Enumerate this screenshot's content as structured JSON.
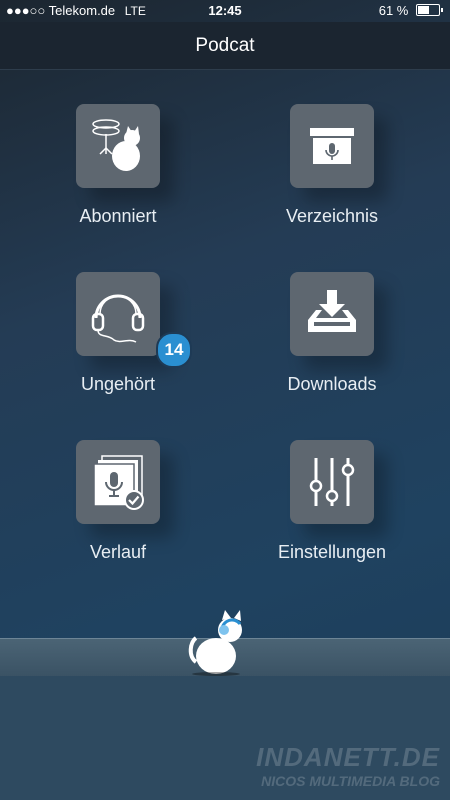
{
  "status_bar": {
    "signal": "●●●○○",
    "carrier": "Telekom.de",
    "network": "LTE",
    "time": "12:45",
    "battery_percent": "61 %",
    "battery_level": 0.61
  },
  "navbar": {
    "title": "Podcat"
  },
  "menu": {
    "subscribed": {
      "label": "Abonniert",
      "icon": "cat-satellite-icon"
    },
    "directory": {
      "label": "Verzeichnis",
      "icon": "archive-box-icon"
    },
    "unplayed": {
      "label": "Ungehört",
      "icon": "headphones-icon",
      "badge": "14"
    },
    "downloads": {
      "label": "Downloads",
      "icon": "download-tray-icon"
    },
    "history": {
      "label": "Verlauf",
      "icon": "history-stack-icon"
    },
    "settings": {
      "label": "Einstellungen",
      "icon": "sliders-icon"
    }
  },
  "watermark": {
    "line1": "INDANETT.DE",
    "line2": "NICOS MULTIMEDIA BLOG"
  },
  "colors": {
    "tile": "#5e6770",
    "badge": "#2a8fd1",
    "navbar": "#1b2530"
  }
}
